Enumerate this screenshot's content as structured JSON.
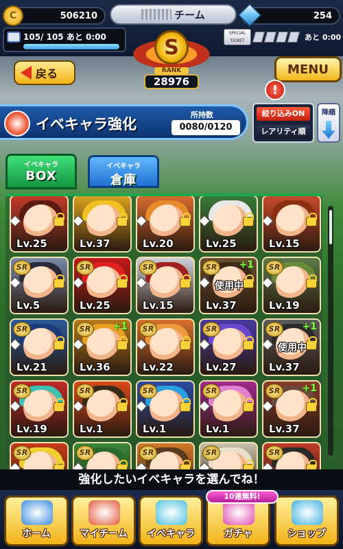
{
  "header": {
    "coins": "506210",
    "team_suffix": "チーム",
    "gems": "254",
    "stamina": "105/ 105",
    "stamina_recovery": "あと  0:00",
    "stamina_fraction": 1.0,
    "ticket_recovery": "あと  0:00",
    "ticket_label": "SPECIAL TICKET"
  },
  "rank": {
    "grade": "S",
    "label": "RANK",
    "value": "28976"
  },
  "nav": {
    "back_label": "戻る",
    "menu_label": "MENU",
    "alert_symbol": "!"
  },
  "title": {
    "text": "イベキャラ強化",
    "owned_label": "所持数",
    "owned_value": "0080/0120"
  },
  "filter": {
    "filter_label": "絞り込みON",
    "sort_label": "レアリティ順",
    "order_label": "降順"
  },
  "tabs": [
    {
      "small": "イベキャラ",
      "big": "BOX"
    },
    {
      "small": "イベキャラ",
      "big": "倉庫"
    }
  ],
  "cards": [
    {
      "level": "Lv.25",
      "rarity": "",
      "in_use": "",
      "plus": "",
      "bg": "#c23a2a",
      "hair": "#5a1a10"
    },
    {
      "level": "Lv.37",
      "rarity": "",
      "in_use": "",
      "plus": "",
      "bg": "#d8a020",
      "hair": "#f0c020"
    },
    {
      "level": "Lv.20",
      "rarity": "",
      "in_use": "",
      "plus": "",
      "bg": "#d86a30",
      "hair": "#e88a2a"
    },
    {
      "level": "Lv.25",
      "rarity": "",
      "in_use": "",
      "plus": "",
      "bg": "#3a7a3a",
      "hair": "#e8e8e8"
    },
    {
      "level": "Lv.15",
      "rarity": "",
      "in_use": "",
      "plus": "",
      "bg": "#c84a2a",
      "hair": "#8a3010"
    },
    {
      "level": "Lv.5",
      "rarity": "SR",
      "in_use": "",
      "plus": "",
      "bg": "#7a8aa8",
      "hair": "#2a2a3a"
    },
    {
      "level": "Lv.25",
      "rarity": "SR",
      "in_use": "",
      "plus": "",
      "bg": "#c01a1a",
      "hair": "#e02020"
    },
    {
      "level": "Lv.15",
      "rarity": "SR",
      "in_use": "",
      "plus": "",
      "bg": "#d0d0d8",
      "hair": "#a02020"
    },
    {
      "level": "Lv.37",
      "rarity": "SR",
      "in_use": "使用中",
      "plus": "+1",
      "bg": "#6a5030",
      "hair": "#3a2a1a"
    },
    {
      "level": "Lv.19",
      "rarity": "SR",
      "in_use": "",
      "plus": "",
      "bg": "#5a7a4a",
      "hair": "#6a8a3a"
    },
    {
      "level": "Lv.21",
      "rarity": "SR",
      "in_use": "",
      "plus": "",
      "bg": "#2a5a9a",
      "hair": "#1a3a7a"
    },
    {
      "level": "Lv.36",
      "rarity": "SR",
      "in_use": "",
      "plus": "+1",
      "bg": "#b87a1a",
      "hair": "#e8a020"
    },
    {
      "level": "Lv.22",
      "rarity": "SR",
      "in_use": "",
      "plus": "",
      "bg": "#d8702a",
      "hair": "#f09a40"
    },
    {
      "level": "Lv.27",
      "rarity": "SR",
      "in_use": "",
      "plus": "",
      "bg": "#4a3aa0",
      "hair": "#6a4ad0"
    },
    {
      "level": "Lv.37",
      "rarity": "SR",
      "in_use": "使用中",
      "plus": "+1",
      "bg": "#5a5a5a",
      "hair": "#2a2a2a"
    },
    {
      "level": "Lv.19",
      "rarity": "SR",
      "in_use": "",
      "plus": "",
      "bg": "#c02a2a",
      "hair": "#40c0b0"
    },
    {
      "level": "Lv.1",
      "rarity": "SR",
      "in_use": "",
      "plus": "",
      "bg": "#d84a1a",
      "hair": "#3a2a1a"
    },
    {
      "level": "Lv.1",
      "rarity": "SR",
      "in_use": "",
      "plus": "",
      "bg": "#2a4aa0",
      "hair": "#2aa0e0"
    },
    {
      "level": "Lv.1",
      "rarity": "SR",
      "in_use": "",
      "plus": "",
      "bg": "#a02a8a",
      "hair": "#e080d0"
    },
    {
      "level": "Lv.37",
      "rarity": "SR",
      "in_use": "",
      "plus": "+1",
      "bg": "#8a3a2a",
      "hair": "#6a4a3a"
    },
    {
      "level": "",
      "rarity": "SR",
      "in_use": "",
      "plus": "",
      "bg": "#c83a1a",
      "hair": "#f0d030"
    },
    {
      "level": "",
      "rarity": "SR",
      "in_use": "",
      "plus": "",
      "bg": "#3a8a3a",
      "hair": "#2a6a2a"
    },
    {
      "level": "",
      "rarity": "SR",
      "in_use": "",
      "plus": "",
      "bg": "#d07a2a",
      "hair": "#5a3a1a"
    },
    {
      "level": "",
      "rarity": "SR",
      "in_use": "",
      "plus": "",
      "bg": "#c8c0a8",
      "hair": "#e8e0c8"
    },
    {
      "level": "",
      "rarity": "SR",
      "in_use": "",
      "plus": "",
      "bg": "#c03a2a",
      "hair": "#2a2a2a"
    }
  ],
  "instruction": "強化したいイベキャラを選んでね！",
  "bottom_nav": [
    {
      "label": "ホーム",
      "art": "#3a8ae0"
    },
    {
      "label": "マイチーム",
      "art": "#e05a3a"
    },
    {
      "label": "イベキャラ",
      "art": "#4ac0e0"
    },
    {
      "label": "ガチャ",
      "art": "#e04ab0"
    },
    {
      "label": "ショップ",
      "art": "#40b0e0"
    }
  ],
  "gacha_promo": "10連無料!"
}
